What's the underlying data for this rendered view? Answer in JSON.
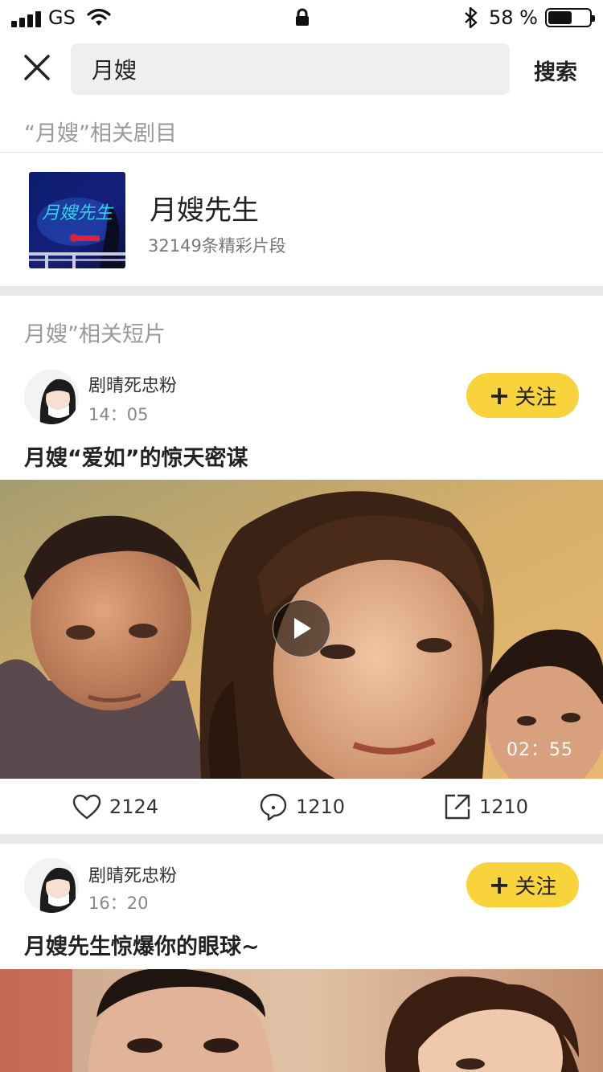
{
  "status_bar": {
    "carrier": "GS",
    "battery_text": "58 %",
    "battery_level": 0.58
  },
  "search": {
    "value": "月嫂",
    "button_label": "搜索"
  },
  "related_dramas": {
    "title": "“月嫂”相关剧目",
    "items": [
      {
        "poster_text": "月嫂先生",
        "name": "月嫂先生",
        "count_text": "32149条精彩片段"
      }
    ]
  },
  "related_clips": {
    "title": "月嫂”相关短片",
    "posts": [
      {
        "author": "剧晴死忠粉",
        "time": "14：05",
        "follow_label": "关注",
        "title": "月嫂“爱如”的惊天密谋",
        "duration": "02：55",
        "likes": "2124",
        "comments": "1210",
        "shares": "1210"
      },
      {
        "author": "剧晴死忠粉",
        "time": "16：20",
        "follow_label": "关注",
        "title": "月嫂先生惊爆你的眼球~"
      }
    ]
  },
  "colors": {
    "accent": "#f9d33c",
    "muted_text": "#9a9a9a",
    "separator": "#e8e8e8"
  }
}
